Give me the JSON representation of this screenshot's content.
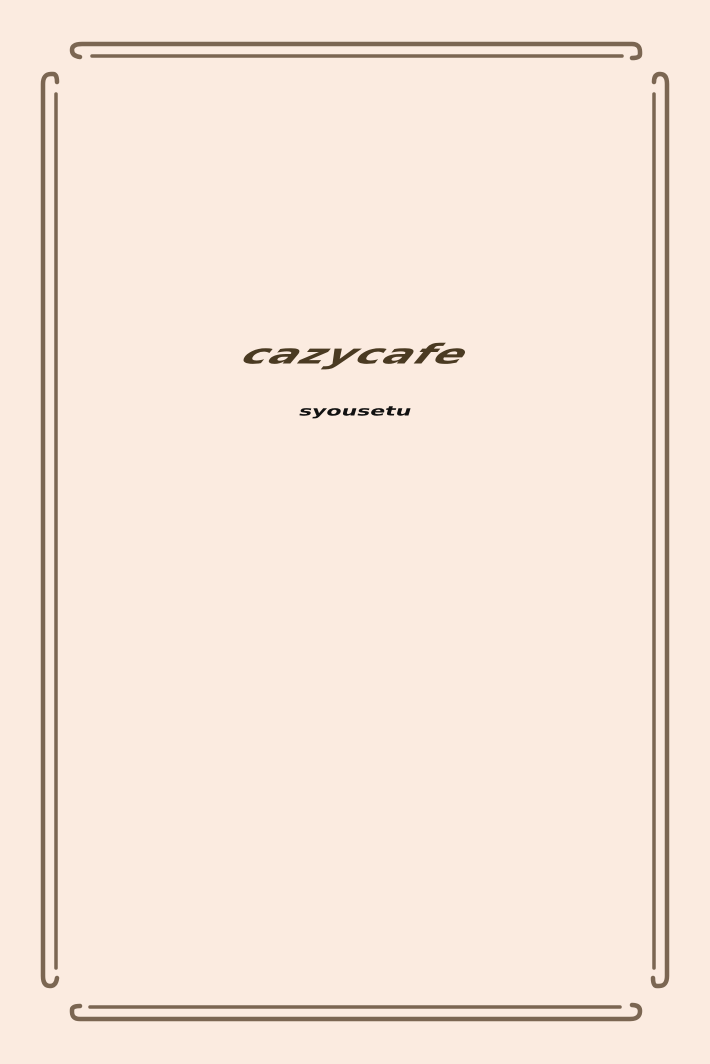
{
  "cover": {
    "title": "cazycafe",
    "author": "syousetu"
  },
  "colors": {
    "background": "#fbebe0",
    "frame": "#7b6652",
    "title": "#4a3a22",
    "author": "#111111"
  }
}
